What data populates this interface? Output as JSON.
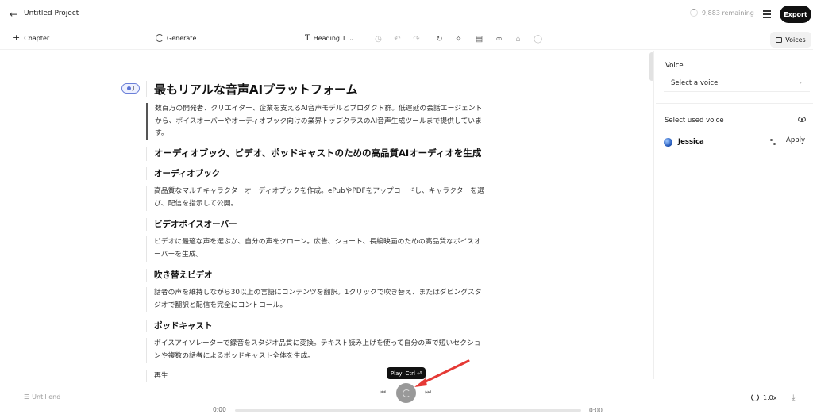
{
  "header": {
    "back_icon": "arrow-left-icon",
    "project_title": "Untitled Project",
    "remaining": "9,883 remaining",
    "export_label": "Export"
  },
  "toolbar": {
    "chapter_label": "Chapter",
    "generate_label": "Generate",
    "heading_select": "Heading 1",
    "voices_label": "Voices"
  },
  "editor": {
    "speaker_initial": "J",
    "blocks": [
      {
        "type": "h1",
        "text": "最もリアルな音声AIプラットフォーム"
      },
      {
        "type": "p",
        "text": "数百万の開発者、クリエイター、企業を支えるAI音声モデルとプロダクト群。低遅延の会話エージェント"
      },
      {
        "type": "p",
        "text": "から、ボイスオーバーやオーディオブック向けの業界トップクラスのAI音声生成ツールまで提供していま"
      },
      {
        "type": "p",
        "text": "す。"
      },
      {
        "type": "h2",
        "text": "オーディオブック、ビデオ、ポッドキャストのための高品質AIオーディオを生成"
      },
      {
        "type": "h3",
        "text": "オーディオブック"
      },
      {
        "type": "p",
        "text": "高品質なマルチキャラクターオーディオブックを作成。ePubやPDFをアップロードし、キャラクターを選"
      },
      {
        "type": "p",
        "text": "び、配信を指示して公開。"
      },
      {
        "type": "h3",
        "text": "ビデオボイスオーバー"
      },
      {
        "type": "p",
        "text": "ビデオに最適な声を選ぶか、自分の声をクローン。広告、ショート、長編映画のための高品質なボイスオ"
      },
      {
        "type": "p",
        "text": "ーバーを生成。"
      },
      {
        "type": "h3",
        "text": "吹き替えビデオ"
      },
      {
        "type": "p",
        "text": "話者の声を維持しながら30以上の言語にコンテンツを翻訳。1クリックで吹き替え、またはダビングスタ"
      },
      {
        "type": "p",
        "text": "ジオで翻訳と配信を完全にコントロール。"
      },
      {
        "type": "h3",
        "text": "ポッドキャスト"
      },
      {
        "type": "p",
        "text": "ボイスアイソレーターで録音をスタジオ品質に変換。テキスト読み上げを使って自分の声で短いセクショ"
      },
      {
        "type": "p",
        "text": "ンや複数の話者によるポッドキャスト全体を生成。"
      },
      {
        "type": "h3",
        "text": "再生"
      }
    ]
  },
  "panel": {
    "voice_label": "Voice",
    "voice_select_placeholder": "Select a voice",
    "used_voice_label": "Select used voice",
    "used_voice_name": "Jessica",
    "apply_label": "Apply"
  },
  "player": {
    "until_end": "Until end",
    "tooltip_label": "Play",
    "tooltip_shortcut": "Ctrl ⏎",
    "time_start": "0:00",
    "time_end": "0:00",
    "speed": "1.0x",
    "progress": 0
  },
  "colors": {
    "accent": "#111111",
    "speaker_chip": "#6a7fd8",
    "annotation_arrow": "#e53935"
  }
}
